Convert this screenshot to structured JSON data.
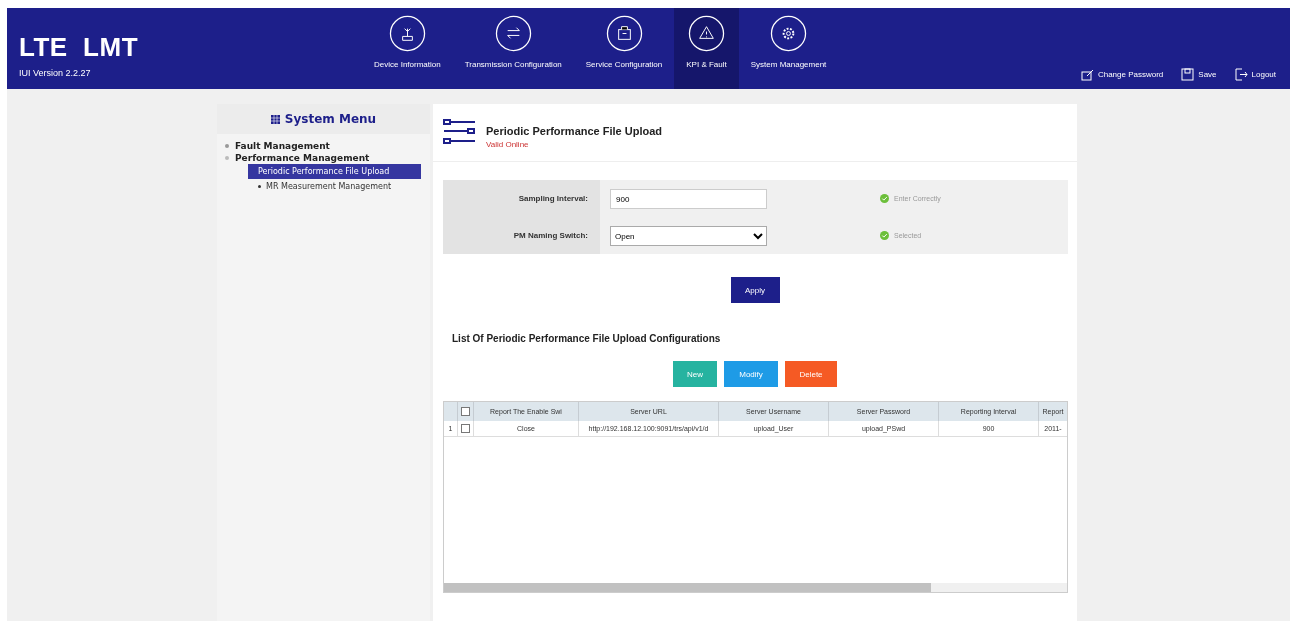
{
  "header": {
    "title": "LTE  LMT",
    "version": "IUI Version 2.2.27",
    "nav": [
      {
        "kind": "device",
        "label": "Device Information",
        "selected": false
      },
      {
        "kind": "transfer",
        "label": "Transmission Configuration",
        "selected": false
      },
      {
        "kind": "service",
        "label": "Service Configuration",
        "selected": false
      },
      {
        "kind": "warning",
        "label": "KPI & Fault",
        "selected": true
      },
      {
        "kind": "gear",
        "label": "System Management",
        "selected": false
      }
    ],
    "actions": [
      {
        "kind": "password",
        "label": "Change Password"
      },
      {
        "kind": "save",
        "label": "Save"
      },
      {
        "kind": "logout",
        "label": "Logout"
      }
    ]
  },
  "sidebar": {
    "title": "System Menu",
    "items": [
      {
        "label": "Fault Management",
        "expanded": false
      },
      {
        "label": "Performance Management",
        "expanded": true,
        "children": [
          {
            "label": "Periodic Performance File Upload",
            "selected": true
          },
          {
            "label": "MR Measurement Management",
            "selected": false
          }
        ]
      }
    ]
  },
  "page": {
    "title": "Periodic Performance File Upload",
    "subtitle": "Valid Online"
  },
  "form": {
    "fields": [
      {
        "kind": "input",
        "label": "Sampling Interval:",
        "value": "900",
        "status": "Enter Correctly"
      },
      {
        "kind": "select",
        "label": "PM Naming Switch:",
        "value": "Open",
        "status": "Selected"
      }
    ],
    "apply": "Apply"
  },
  "list": {
    "title": "List Of Periodic Performance File Upload Configurations",
    "buttons": [
      {
        "kind": "new",
        "label": "New"
      },
      {
        "kind": "modify",
        "label": "Modify"
      },
      {
        "kind": "delete",
        "label": "Delete"
      }
    ],
    "columns": [
      "Report The Enable Swi",
      "Server URL",
      "Server Username",
      "Server Password",
      "Reporting Interval",
      "Report"
    ],
    "all_checked": false,
    "rows": [
      {
        "index": "1",
        "checked": false,
        "cells": [
          "Close",
          "http://192.168.12.100:9091/trs/api/v1/d",
          "upload_User",
          "upload_PSwd",
          "900",
          "2011-"
        ]
      }
    ]
  }
}
